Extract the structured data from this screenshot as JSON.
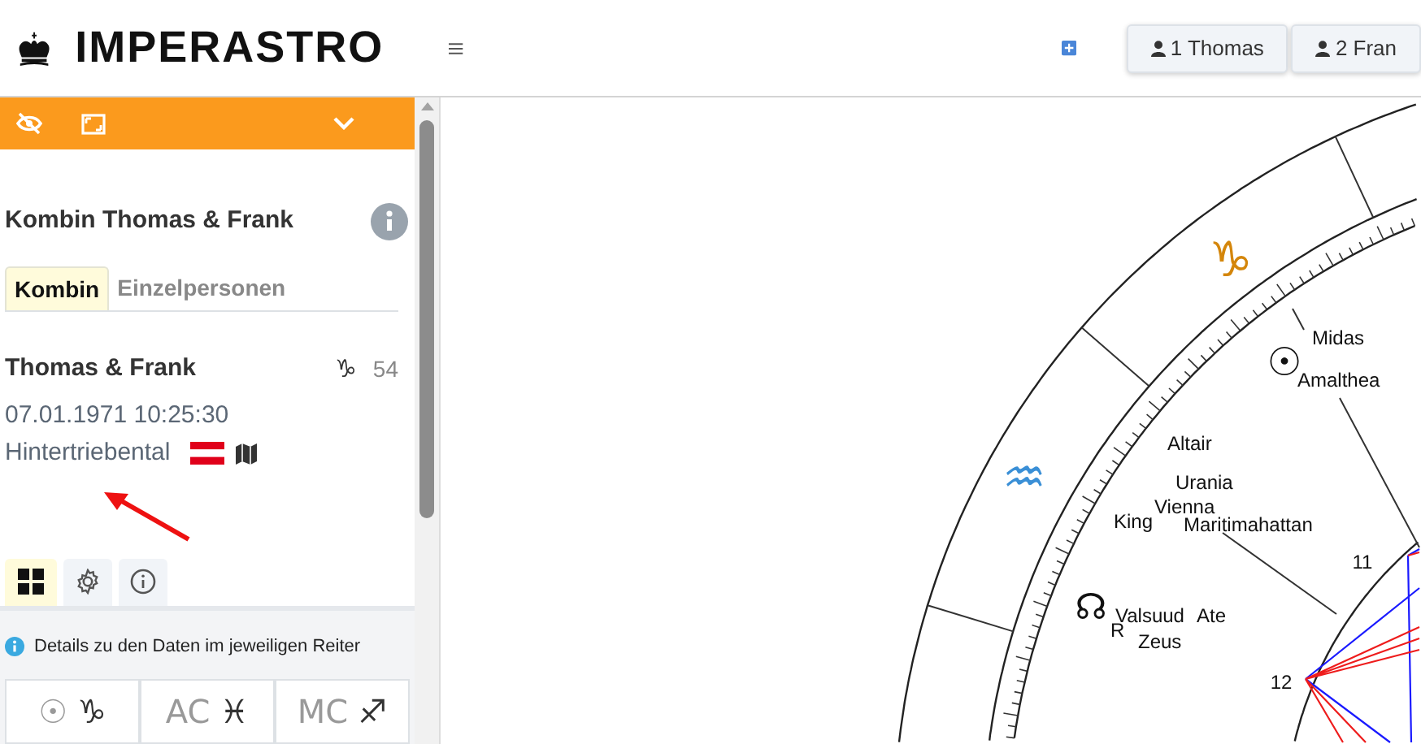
{
  "header": {
    "logo": "IMPERASTRO",
    "persons": [
      {
        "label": "1 Thomas"
      },
      {
        "label": "2 Fran"
      }
    ]
  },
  "sidebar": {
    "title": "Kombin Thomas & Frank",
    "tabs": [
      {
        "label": "Kombin",
        "selected": true
      },
      {
        "label": "Einzelpersonen",
        "selected": false
      }
    ],
    "person": {
      "name": "Thomas & Frank",
      "sign": "♑",
      "value": "54",
      "datetime": "07.01.1971 10:25:30",
      "place": "Hintertriebental"
    },
    "icon_tabs": [
      {
        "kind": "grid",
        "selected": true
      },
      {
        "kind": "gear",
        "selected": false
      },
      {
        "kind": "info",
        "selected": false
      }
    ],
    "info_text": "Details zu den Daten im jeweiligen Reiter",
    "summary": [
      {
        "label": "☉",
        "sign": "♑"
      },
      {
        "label": "AC",
        "sign": "♓"
      },
      {
        "label": "MC",
        "sign": "♐"
      }
    ]
  },
  "chart": {
    "signs": [
      {
        "glyph": "♑",
        "color": "#d4860b"
      },
      {
        "glyph": "♒",
        "color": "#3a8fd6"
      }
    ],
    "bodies": [
      {
        "glyph": "☉"
      },
      {
        "glyph": "☊"
      }
    ],
    "labels": [
      "Midas",
      "Amalthea",
      "Altair",
      "Urania",
      "Vienna",
      "King",
      "Maritimahattan",
      "Valsuud",
      "R",
      "Zeus",
      "Ate"
    ],
    "house_numbers": [
      "11",
      "12"
    ]
  }
}
